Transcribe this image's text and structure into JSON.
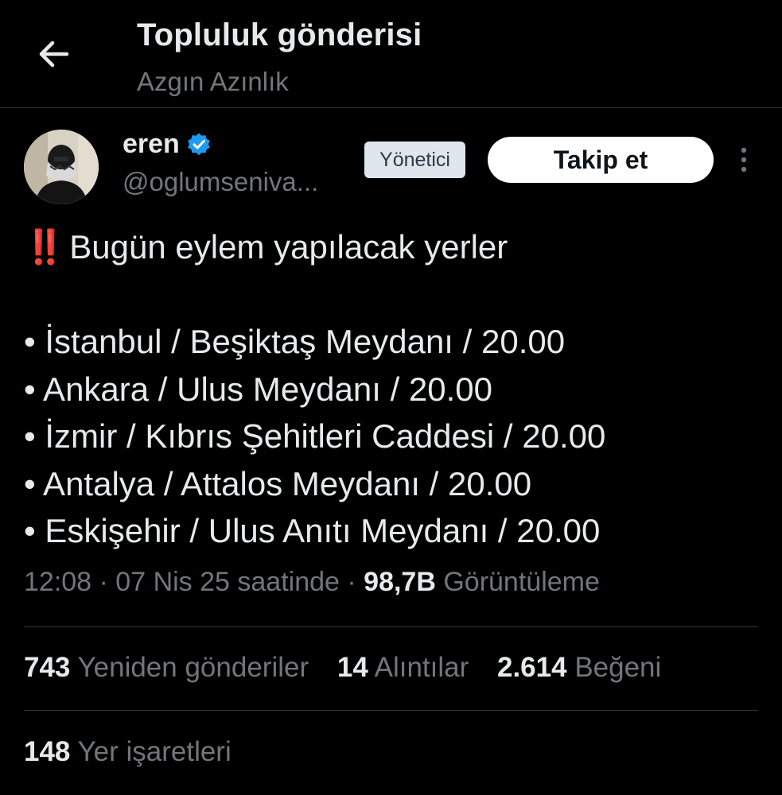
{
  "header": {
    "title": "Topluluk gönderisi",
    "community": "Azgın Azınlık",
    "back_icon": "arrow-left-icon"
  },
  "author": {
    "name": "eren",
    "handle": "@oglumseniva...",
    "verified_icon": "verified-badge-icon",
    "role_badge": "Yönetici",
    "follow_label": "Takip et",
    "more_icon": "more-vertical-icon"
  },
  "post": {
    "emoji": "‼️",
    "headline": "Bugün eylem yapılacak yerler",
    "items": [
      "• İstanbul / Beşiktaş Meydanı / 20.00",
      "• Ankara / Ulus Meydanı / 20.00",
      "• İzmir / Kıbrıs Şehitleri Caddesi / 20.00",
      "• Antalya / Attalos Meydanı / 20.00",
      "• Eskişehir / Ulus Anıtı Meydanı / 20.00"
    ]
  },
  "meta": {
    "time_date": "12:08 · 07 Nis 25 saatinde · ",
    "views": "98,7B",
    "views_label": " Görüntüleme"
  },
  "stats": {
    "reposts": "743",
    "reposts_label": "Yeniden gönderiler",
    "quotes": "14",
    "quotes_label": "Alıntılar",
    "likes": "2.614",
    "likes_label": "Beğeni",
    "bookmarks": "148",
    "bookmarks_label": "Yer işaretleri"
  },
  "colors": {
    "background": "#000000",
    "text": "#e7e9ea",
    "secondary": "#71767b",
    "verified": "#1d9bf0",
    "exclamation": "#f91880"
  }
}
